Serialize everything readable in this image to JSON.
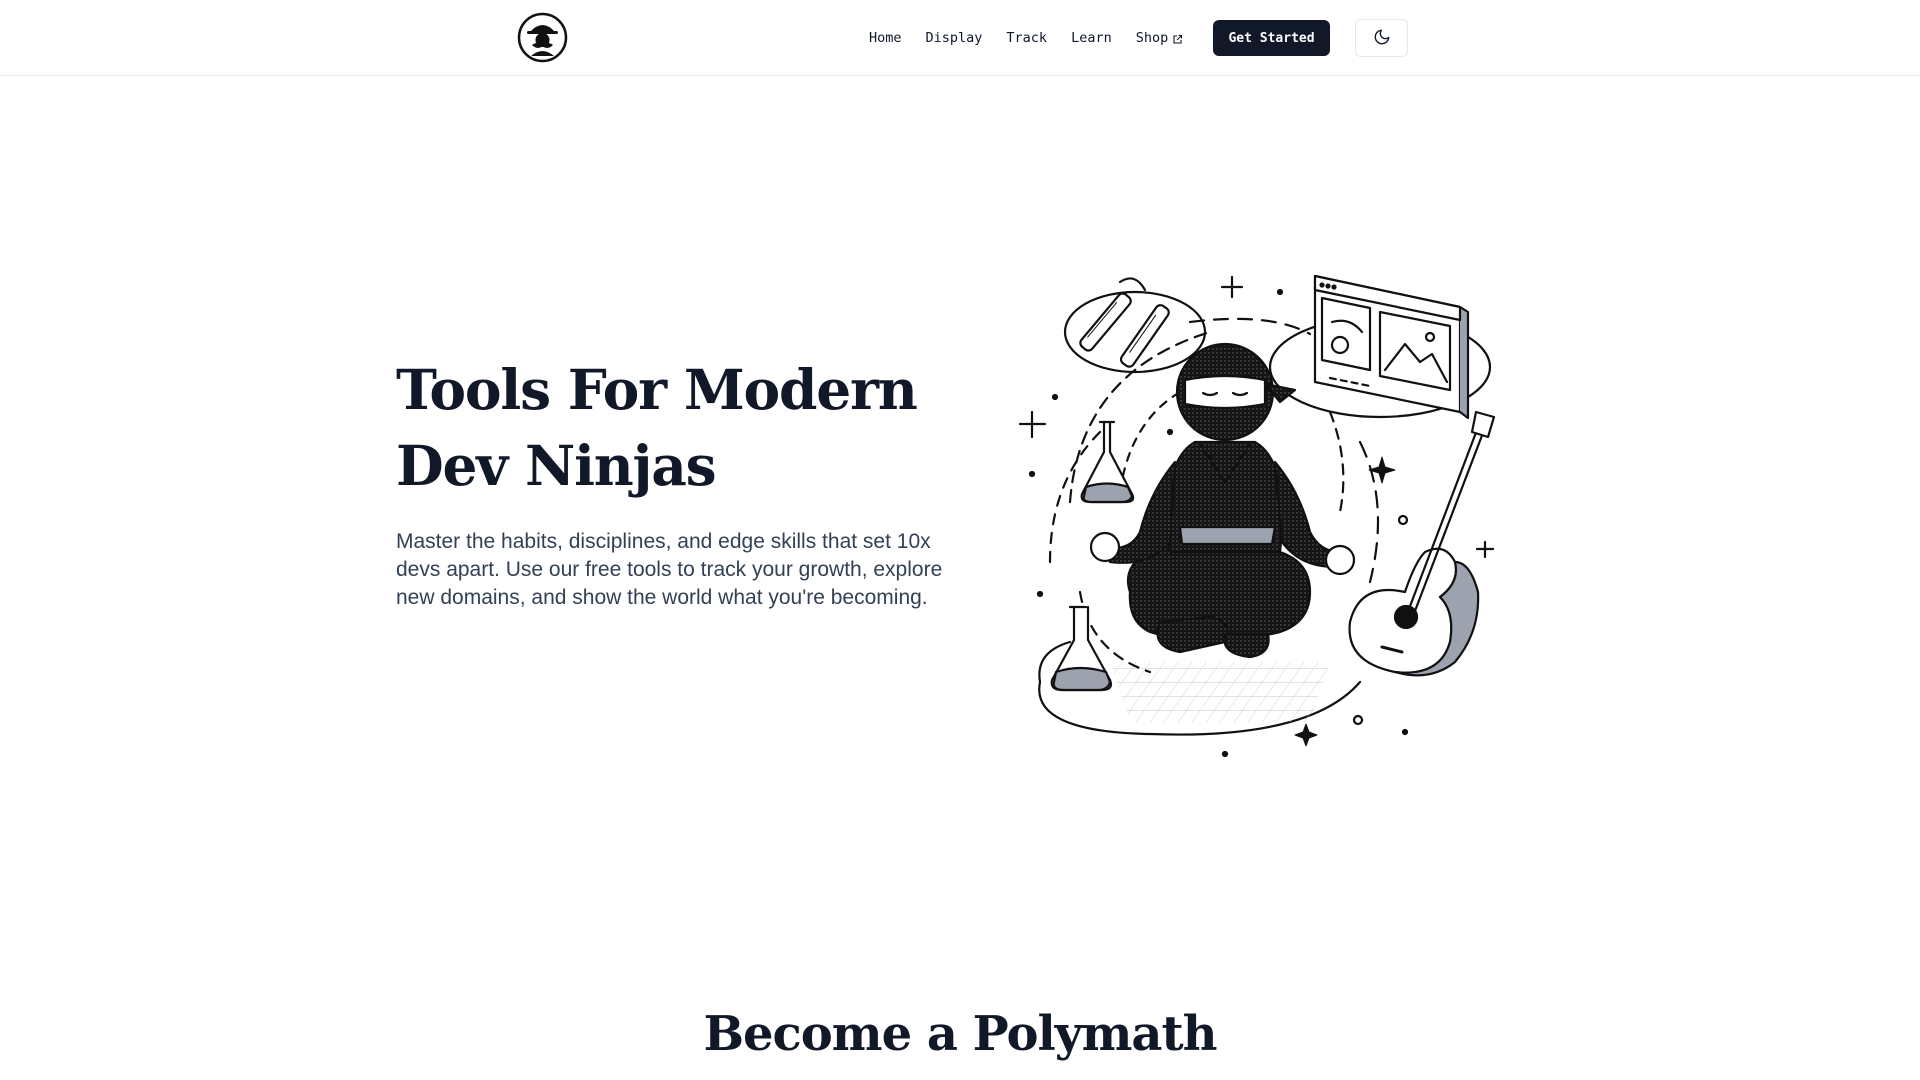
{
  "header": {
    "logo_icon": "ninja-logo-icon",
    "nav": [
      {
        "label": "Home"
      },
      {
        "label": "Display"
      },
      {
        "label": "Track"
      },
      {
        "label": "Learn"
      },
      {
        "label": "Shop",
        "icon": "external-link-icon"
      }
    ],
    "cta_label": "Get Started",
    "theme_toggle_icon": "moon-icon"
  },
  "hero": {
    "title_line1": "Tools For Modern",
    "title_line2": "Dev Ninjas",
    "description": "Master the habits, disciplines, and edge skills that set 10x devs apart. Use our free tools to track your growth, explore new domains, and show the world what you're becoming.",
    "illustration": "meditating-ninja-illustration"
  },
  "section": {
    "title": "Become a Polymath"
  },
  "colors": {
    "text_primary": "#111827",
    "text_secondary": "#334155",
    "button_bg": "#111827",
    "border": "#e5e7eb"
  }
}
